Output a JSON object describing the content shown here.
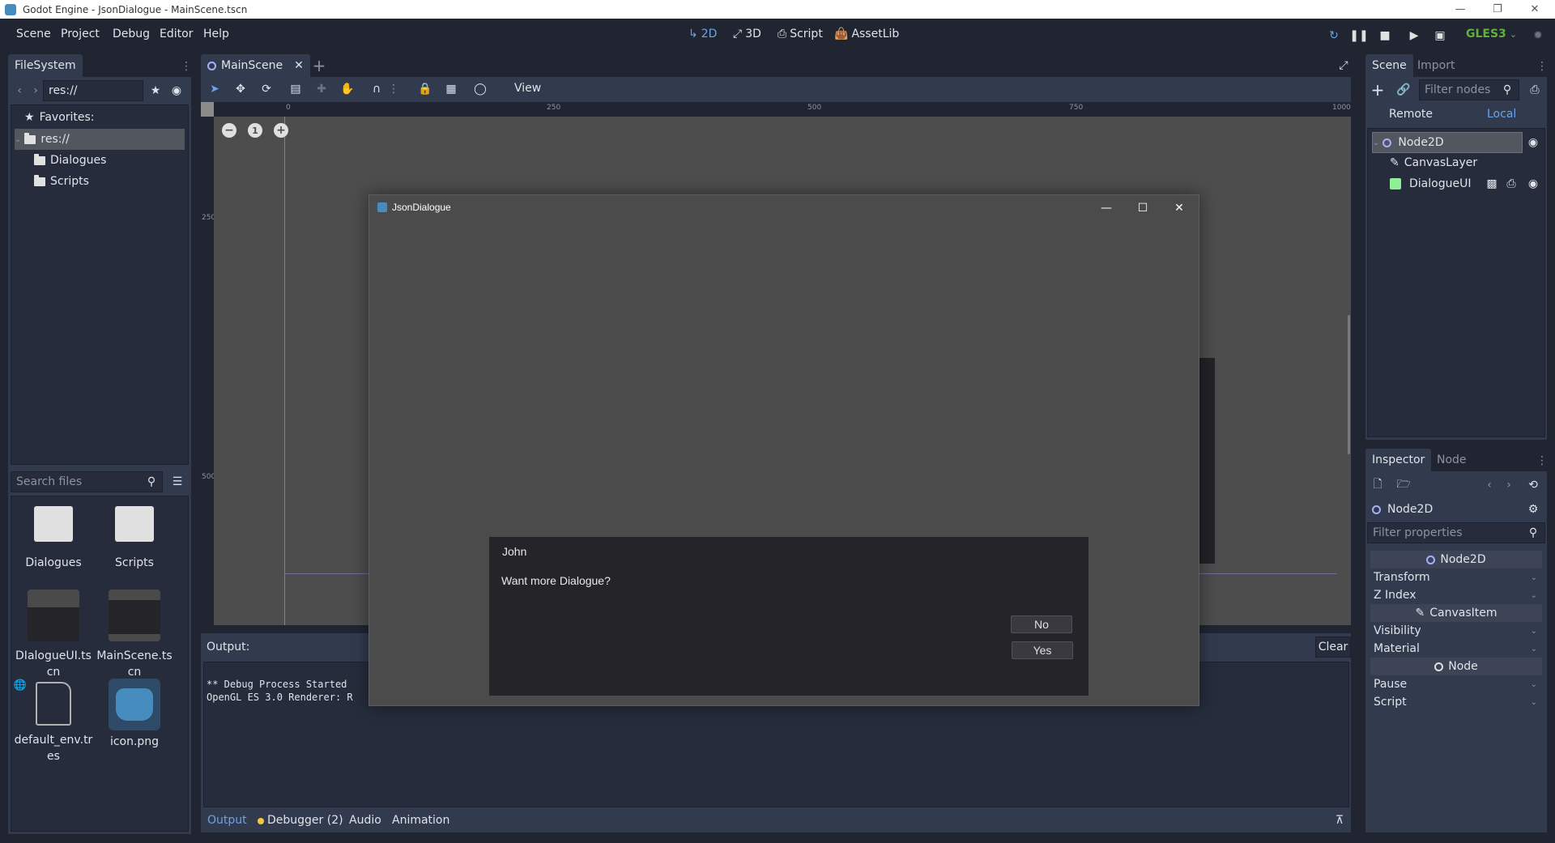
{
  "window": {
    "title": "Godot Engine - JsonDialogue - MainScene.tscn",
    "controls": [
      "minimize",
      "restore",
      "close"
    ]
  },
  "menu": [
    "Scene",
    "Project",
    "Debug",
    "Editor",
    "Help"
  ],
  "workspaces": [
    {
      "label": "2D",
      "icon": "2d-axis-icon",
      "active": true
    },
    {
      "label": "3D",
      "icon": "3d-axis-icon",
      "active": false
    },
    {
      "label": "Script",
      "icon": "script-icon",
      "active": false
    },
    {
      "label": "AssetLib",
      "icon": "assetlib-icon",
      "active": false
    }
  ],
  "run_controls": [
    "reload-icon",
    "pause-icon",
    "stop-icon",
    "play-scene-icon",
    "play-custom-scene-icon"
  ],
  "renderer": {
    "label": "GLES3",
    "color": "#5fb13c"
  },
  "filesystem": {
    "tab": "FileSystem",
    "path": "res://",
    "favorites_label": "Favorites:",
    "tree": [
      {
        "label": "res://",
        "level": 0,
        "selected": true
      },
      {
        "label": "Dialogues",
        "level": 1
      },
      {
        "label": "Scripts",
        "level": 1
      }
    ],
    "search_placeholder": "Search files",
    "files": [
      {
        "name": "Dialogues",
        "type": "folder"
      },
      {
        "name": "Scripts",
        "type": "folder"
      },
      {
        "name": "DIalogueUI.tscn",
        "type": "scene"
      },
      {
        "name": "MainScene.tscn",
        "type": "scene"
      },
      {
        "name": "default_env.tres",
        "type": "resource"
      },
      {
        "name": "icon.png",
        "type": "image"
      }
    ]
  },
  "editor": {
    "scene_tab": "MainScene",
    "view_menu": "View",
    "ruler_h": [
      "0",
      "250",
      "500",
      "750",
      "1000"
    ],
    "ruler_v": [
      "250",
      "500"
    ],
    "zoom_controls": [
      "zoom-out-icon",
      "zoom-reset-icon",
      "zoom-in-icon"
    ]
  },
  "game_window": {
    "title": "JsonDialogue",
    "dialogue": {
      "speaker": "John",
      "text": "Want more Dialogue?",
      "choices": [
        "No",
        "Yes"
      ]
    }
  },
  "output": {
    "label": "Output:",
    "clear_label": "Clear",
    "lines": [
      "** Debug Process Started",
      "OpenGL ES 3.0 Renderer: R"
    ],
    "tabs": [
      {
        "label": "Output",
        "active": true
      },
      {
        "label": "Debugger (2)",
        "badge": true
      },
      {
        "label": "Audio"
      },
      {
        "label": "Animation"
      }
    ]
  },
  "scene_dock": {
    "tabs": [
      "Scene",
      "Import"
    ],
    "filter_placeholder": "Filter nodes",
    "remote_label": "Remote",
    "local_label": "Local",
    "nodes": [
      {
        "name": "Node2D",
        "level": 0,
        "selected": true
      },
      {
        "name": "CanvasLayer",
        "level": 1
      },
      {
        "name": "DialogueUI",
        "level": 1
      }
    ]
  },
  "inspector": {
    "tabs": [
      "Inspector",
      "Node"
    ],
    "object": "Node2D",
    "filter_placeholder": "Filter properties",
    "sections": [
      {
        "header": "Node2D",
        "rows": [
          "Transform",
          "Z Index"
        ]
      },
      {
        "header": "CanvasItem",
        "rows": [
          "Visibility",
          "Material"
        ]
      },
      {
        "header": "Node",
        "rows": [
          "Pause",
          "Script"
        ]
      }
    ]
  }
}
